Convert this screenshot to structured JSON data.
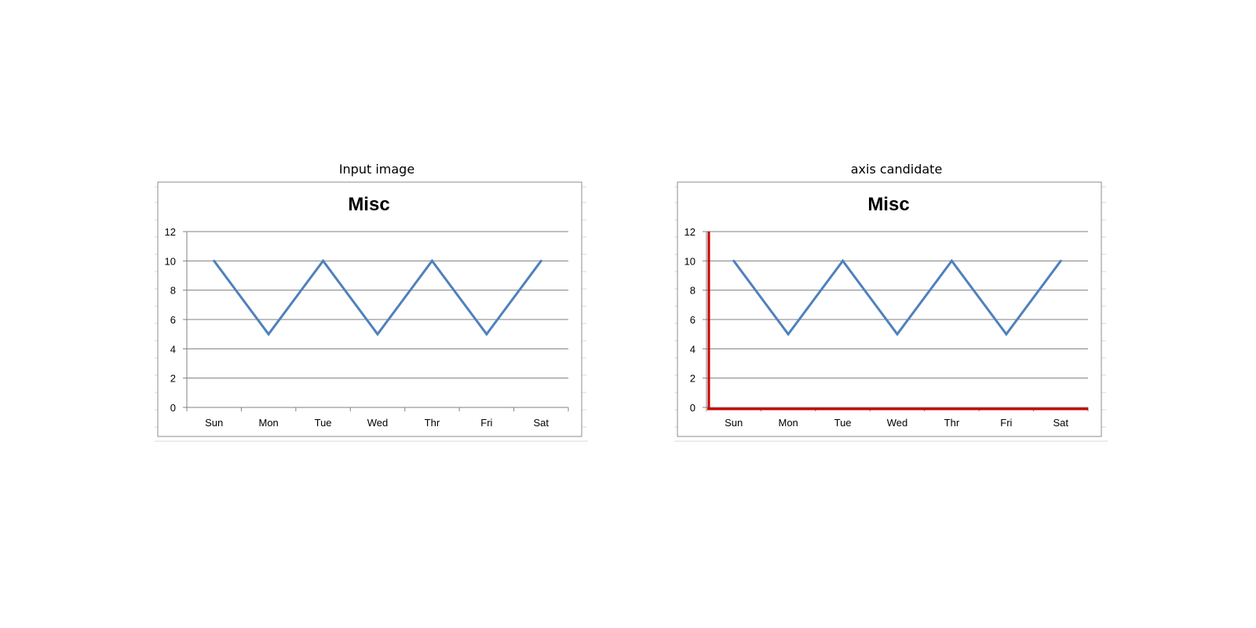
{
  "panels": [
    {
      "title": "Input image",
      "highlight_axes": false
    },
    {
      "title": "axis candidate",
      "highlight_axes": true
    }
  ],
  "highlight_color": "#cc0000",
  "chart_data": [
    {
      "type": "line",
      "title": "Misc",
      "categories": [
        "Sun",
        "Mon",
        "Tue",
        "Wed",
        "Thr",
        "Fri",
        "Sat"
      ],
      "series": [
        {
          "values": [
            10,
            5,
            10,
            5,
            10,
            5,
            10
          ],
          "color": "#4f81bd"
        }
      ],
      "yticks": [
        "0",
        "2",
        "4",
        "6",
        "8",
        "10",
        "12"
      ],
      "ylim": [
        0,
        12
      ],
      "grid": true,
      "xlabel": "",
      "ylabel": ""
    },
    {
      "type": "line",
      "title": "Misc",
      "categories": [
        "Sun",
        "Mon",
        "Tue",
        "Wed",
        "Thr",
        "Fri",
        "Sat"
      ],
      "series": [
        {
          "values": [
            10,
            5,
            10,
            5,
            10,
            5,
            10
          ],
          "color": "#4f81bd"
        }
      ],
      "yticks": [
        "0",
        "2",
        "4",
        "6",
        "8",
        "10",
        "12"
      ],
      "ylim": [
        0,
        12
      ],
      "grid": true,
      "xlabel": "",
      "ylabel": ""
    }
  ]
}
